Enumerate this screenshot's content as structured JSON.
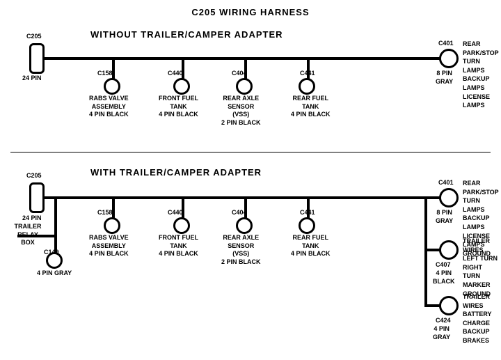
{
  "title": "C205 WIRING HARNESS",
  "section1": {
    "label": "WITHOUT  TRAILER/CAMPER  ADAPTER",
    "connectors": [
      {
        "id": "C205_top",
        "pin": "C205",
        "sub": "24 PIN",
        "type": "rect"
      },
      {
        "id": "C158_top",
        "pin": "C158",
        "sub": "RABS VALVE\nASSEMBLY\n4 PIN BLACK"
      },
      {
        "id": "C440_top",
        "pin": "C440",
        "sub": "FRONT FUEL\nTANK\n4 PIN BLACK"
      },
      {
        "id": "C404_top",
        "pin": "C404",
        "sub": "REAR AXLE\nSENSOR\n(VSS)\n2 PIN BLACK"
      },
      {
        "id": "C441_top",
        "pin": "C441",
        "sub": "REAR FUEL\nTANK\n4 PIN BLACK"
      },
      {
        "id": "C401_top",
        "pin": "C401",
        "sub": "8 PIN\nGRAY",
        "right_label": "REAR PARK/STOP\nTURN LAMPS\nBACKUP LAMPS\nLICENSE LAMPS"
      }
    ]
  },
  "section2": {
    "label": "WITH  TRAILER/CAMPER  ADAPTER",
    "connectors": [
      {
        "id": "C205_bot",
        "pin": "C205",
        "sub": "24 PIN",
        "type": "rect"
      },
      {
        "id": "C158_bot",
        "pin": "C158",
        "sub": "RABS VALVE\nASSEMBLY\n4 PIN BLACK"
      },
      {
        "id": "C440_bot",
        "pin": "C440",
        "sub": "FRONT FUEL\nTANK\n4 PIN BLACK"
      },
      {
        "id": "C404_bot",
        "pin": "C404",
        "sub": "REAR AXLE\nSENSOR\n(VSS)\n2 PIN BLACK"
      },
      {
        "id": "C441_bot",
        "pin": "C441",
        "sub": "REAR FUEL\nTANK\n4 PIN BLACK"
      },
      {
        "id": "C401_bot",
        "pin": "C401",
        "sub": "8 PIN\nGRAY",
        "right_label": "REAR PARK/STOP\nTURN LAMPS\nBACKUP LAMPS\nLICENSE LAMPS\nGROUND"
      },
      {
        "id": "C149",
        "pin": "C149",
        "sub": "4 PIN GRAY"
      },
      {
        "id": "trailer_relay",
        "label": "TRAILER\nRELAY\nBOX"
      },
      {
        "id": "C407",
        "pin": "C407",
        "sub": "4 PIN\nBLACK",
        "right_label": "TRAILER WIRES\nLEFT TURN\nRIGHT TURN\nMARKER\nGROUND"
      },
      {
        "id": "C424",
        "pin": "C424",
        "sub": "4 PIN\nGRAY",
        "right_label": "TRAILER WIRES\nBATTERY CHARGE\nBACKUP\nBRAKES"
      }
    ]
  }
}
